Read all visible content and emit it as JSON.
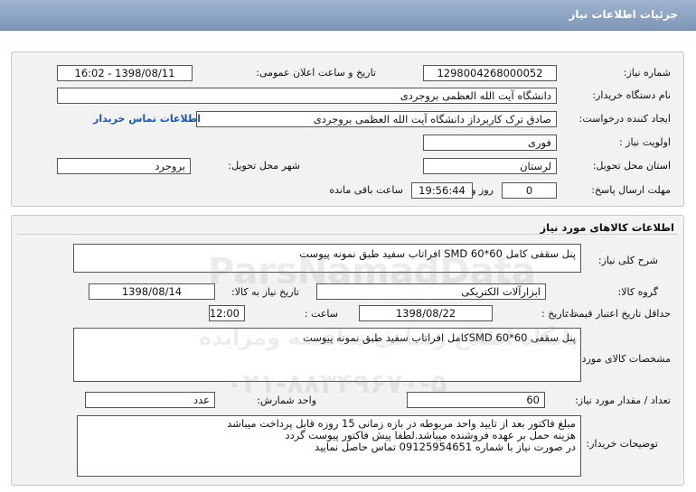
{
  "header": {
    "title": "جزئیات اطلاعات نیاز"
  },
  "need_info": {
    "need_number_label": "شماره نیاز:",
    "need_number": "1298004268000052",
    "announce_label": "تاریخ و ساعت اعلان عمومی:",
    "announce_value": "1398/08/11 - 16:02",
    "buyer_label": "نام دستگاه خریدار:",
    "buyer_value": "دانشگاه آیت الله العظمی بروجردی",
    "creator_label": "ایجاد کننده درخواست:",
    "creator_value": "صادق ترک کاربرداز دانشگاه آیت الله العظمی بروجردی",
    "contact_link": "اطلاعات تماس خریدار",
    "priority_label": "اولویت نیاز :",
    "priority_value": "فوری",
    "province_label": "استان محل تحویل:",
    "province_value": "لرستان",
    "city_label": "شهر محل تحویل:",
    "city_value": "بروجرد",
    "deadline_label": "مهلت ارسال پاسخ:",
    "deadline_days": "0",
    "deadline_day_word": "روز و",
    "deadline_time": "19:56:44",
    "deadline_suffix": "ساعت باقی مانده"
  },
  "goods": {
    "section_title": "اطلاعات کالاهای مورد نیاز",
    "summary_label": "شرح کلی نیاز:",
    "summary_value": "پنل سقفی کامل SMD 60*60 افراتاب سفید طبق نمونه پیوست",
    "group_label": "گروه کالا:",
    "group_value": "ابزارآلات الکتریکی",
    "need_date_label": "تاریخ نیاز به کالا:",
    "need_date_value": "1398/08/14",
    "min_validity_label": "حداقل تاریخ اعتبار قیمت:",
    "until_date_label": "تا تاریخ :",
    "until_date_value": "1398/08/22",
    "hour_label": "ساعت :",
    "hour_value": "12:00",
    "spec_label": "مشخصات کالای مورد نیاز:",
    "spec_value": "پنل سقفی SMD 60*60کامل  افراتاب سفید طبق نمونه پیوست",
    "qty_label": "تعداد / مقدار مورد نیاز:",
    "qty_value": "60",
    "unit_label": "واحد شمارش:",
    "unit_value": "عدد",
    "notes_label": "توضیحات خریدار:",
    "notes_lines": [
      "مبلغ فاکتور بعد از تایید واحد مربوطه در بازه زمانی 15 روزه قابل پرداخت میباشد",
      "هزینه حمل بر عهده فروشنده میباشد.لطفا پیش فاکتور پیوست گردد",
      " در صورت نیاز با شماره 09125954651 تماس حاصل نمایید"
    ]
  },
  "watermark": {
    "line1": "پایگاه اطلاع رسانی مناقصه ومزایده",
    "line2": "ParsNamadData",
    "line3": "۰۲۱-۸۸۳۴۹۶۷۰-۵"
  }
}
